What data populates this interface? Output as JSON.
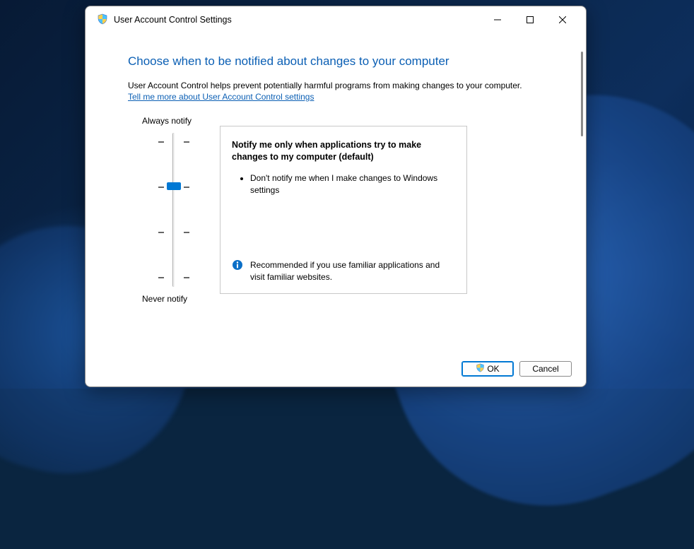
{
  "window": {
    "title": "User Account Control Settings"
  },
  "content": {
    "heading": "Choose when to be notified about changes to your computer",
    "description": "User Account Control helps prevent potentially harmful programs from making changes to your computer.",
    "link": "Tell me more about User Account Control settings"
  },
  "slider": {
    "top_label": "Always notify",
    "bottom_label": "Never notify",
    "levels": 4,
    "current_level": 2
  },
  "panel": {
    "title": "Notify me only when applications try to make changes to my computer (default)",
    "bullets": [
      "Don't notify me when I make changes to Windows settings"
    ],
    "recommendation": "Recommended if you use familiar applications and visit familiar websites."
  },
  "buttons": {
    "ok": "OK",
    "cancel": "Cancel"
  }
}
